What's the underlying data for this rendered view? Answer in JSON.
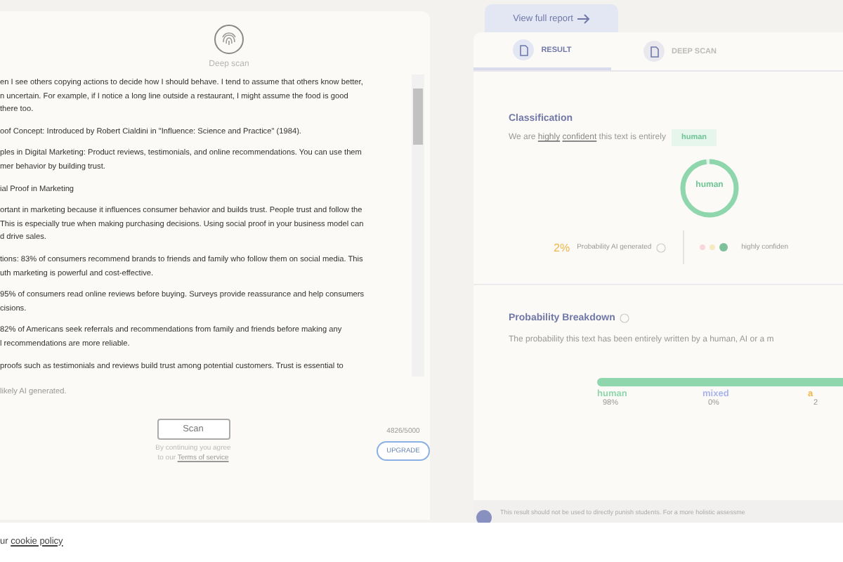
{
  "scanner": {
    "mode_label": "Deep scan",
    "paragraphs": [
      {
        "lines": [
          "en I see others copying actions to decide how I should behave. I tend to assume that others know better,",
          "n uncertain. For example, if I notice a long line outside a restaurant, I might assume the food is good",
          "there too."
        ]
      },
      {
        "lines": [
          "oof Concept: Introduced by Robert Cialdini in \"Influence: Science and Practice\" (1984)."
        ]
      },
      {
        "lines": [
          "ples in Digital Marketing: Product reviews, testimonials, and online recommendations. You can use them",
          "mer behavior by building trust."
        ]
      },
      {
        "lines": [
          "ial Proof in Marketing"
        ]
      },
      {
        "lines": [
          "ortant in marketing because it influences consumer behavior and builds trust. People trust and follow the",
          "This is especially true when making purchasing decisions. Using social proof in your business model can",
          "d drive sales."
        ]
      },
      {
        "lines": [
          "tions: 83% of consumers recommend brands to friends and family who follow them on social media. This",
          "uth marketing is powerful and cost-effective."
        ]
      },
      {
        "lines": [
          "95% of consumers read online reviews before buying. Surveys provide reassurance and help consumers",
          "cisions."
        ]
      },
      {
        "lines": [
          "82% of Americans seek referrals and recommendations from family and friends before making any",
          "l recommendations are more reliable."
        ]
      },
      {
        "lines": [
          "proofs such as testimonials and reviews build trust among potential customers. Trust is essential to"
        ]
      }
    ],
    "hint": "likely AI generated.",
    "scan_button": "Scan",
    "agree_text": "By continuing you agree",
    "agree_prefix": "to our",
    "terms_link": "Terms of service",
    "char_count": "4826/5000",
    "upgrade_button": "UPGRADE"
  },
  "report_link": "View full report",
  "tabs": [
    {
      "label": "RESULT",
      "selected": true
    },
    {
      "label": "DEEP SCAN",
      "selected": false
    }
  ],
  "classification": {
    "title": "Classification",
    "sentence_prefix": "We are",
    "link_1": "highly",
    "link_2": "confident",
    "sentence_suffix": "this text is entirely",
    "tag": "human",
    "donut_label": "human",
    "donut": {
      "level": 0.98
    },
    "ai_percent": "2%",
    "ai_label": "Probability AI generated",
    "confidence_dots": [
      {
        "color": "#f7d6dc",
        "selected": false
      },
      {
        "color": "#f7e9c2",
        "selected": false
      },
      {
        "color": "#7fbf9a",
        "selected": true
      }
    ],
    "confidence_label": "highly confiden"
  },
  "breakdown": {
    "title": "Probability Breakdown",
    "description": "The probability this text has been entirely written by a human, AI or a m",
    "bar": {
      "level": 0.98
    },
    "segments": [
      {
        "kind": "human",
        "label": "human",
        "value": "98%"
      },
      {
        "kind": "mixed",
        "label": "mixed",
        "value": "0%"
      },
      {
        "kind": "ai",
        "label": "a",
        "value": "2"
      }
    ]
  },
  "notice": "This result should not be used to directly punish students. For a more holistic assessme",
  "cookie": {
    "prefix": "ur",
    "link": "cookie policy"
  }
}
